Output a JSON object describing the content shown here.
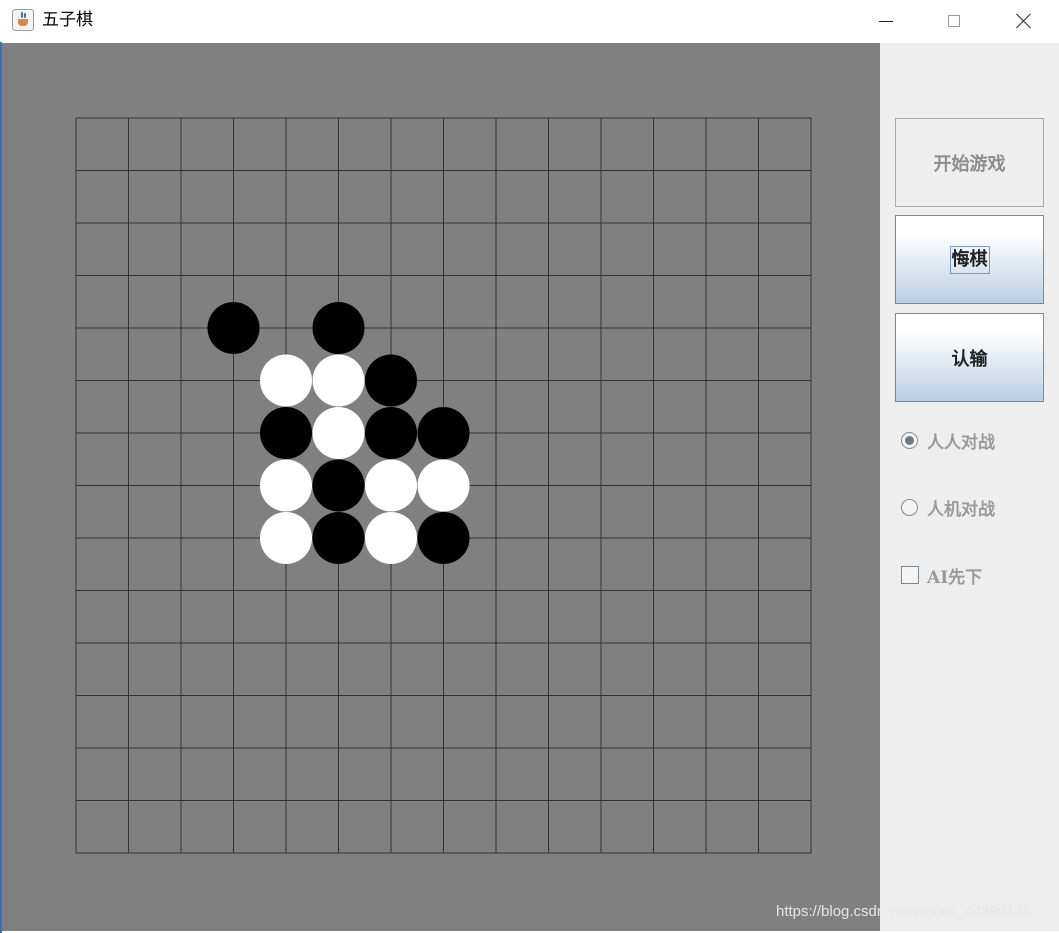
{
  "window": {
    "title": "五子棋",
    "controls": [
      "minimize",
      "maximize",
      "close"
    ]
  },
  "board": {
    "grid_size": 15,
    "board_color": "#808080",
    "line_color": "#333333",
    "black_color": "#000000",
    "white_color": "#ffffff",
    "stones": [
      {
        "col": 3,
        "row": 4,
        "color": "black"
      },
      {
        "col": 5,
        "row": 4,
        "color": "black"
      },
      {
        "col": 4,
        "row": 5,
        "color": "white"
      },
      {
        "col": 5,
        "row": 5,
        "color": "white"
      },
      {
        "col": 6,
        "row": 5,
        "color": "black"
      },
      {
        "col": 4,
        "row": 6,
        "color": "black"
      },
      {
        "col": 5,
        "row": 6,
        "color": "white"
      },
      {
        "col": 6,
        "row": 6,
        "color": "black"
      },
      {
        "col": 7,
        "row": 6,
        "color": "black"
      },
      {
        "col": 4,
        "row": 7,
        "color": "white"
      },
      {
        "col": 5,
        "row": 7,
        "color": "black"
      },
      {
        "col": 6,
        "row": 7,
        "color": "white"
      },
      {
        "col": 7,
        "row": 7,
        "color": "white"
      },
      {
        "col": 4,
        "row": 8,
        "color": "white"
      },
      {
        "col": 5,
        "row": 8,
        "color": "black"
      },
      {
        "col": 6,
        "row": 8,
        "color": "white"
      },
      {
        "col": 7,
        "row": 8,
        "color": "black"
      }
    ]
  },
  "controls": {
    "start_label": "开始游戏",
    "undo_label": "悔棋",
    "resign_label": "认输",
    "mode_pvp_label": "人人对战",
    "mode_pve_label": "人机对战",
    "ai_first_label": "AI先下",
    "selected_mode": "pvp",
    "ai_first_checked": false
  },
  "watermark": "https://blog.csdn.net/weixin_44390145"
}
